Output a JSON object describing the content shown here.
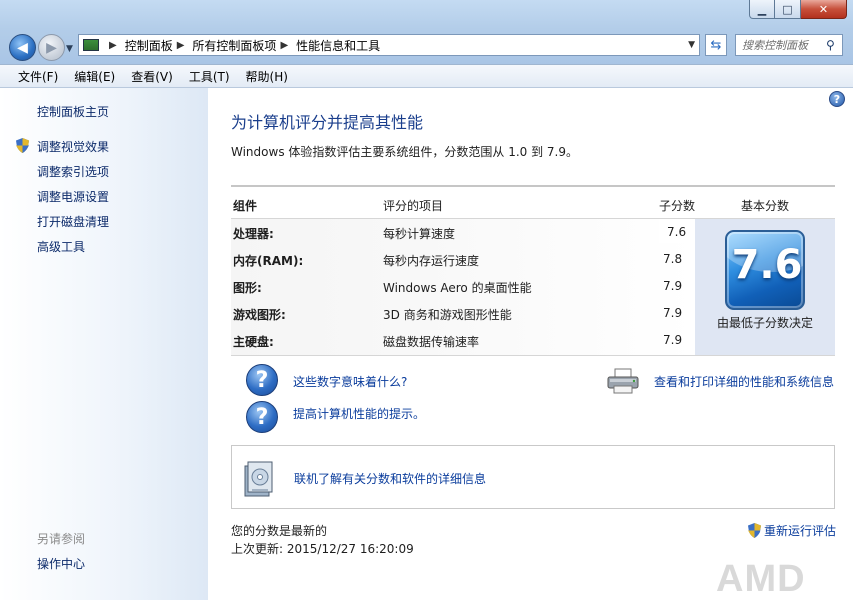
{
  "window": {
    "minimize": "▁",
    "maximize": "□",
    "close": "✕"
  },
  "nav": {
    "back_icon": "back-arrow-icon",
    "forward_icon": "forward-arrow-icon"
  },
  "address": {
    "crumbs": [
      "控制面板",
      "所有控制面板项",
      "性能信息和工具"
    ],
    "separator": "▶"
  },
  "search": {
    "placeholder": "搜索控制面板"
  },
  "menu": [
    "文件(F)",
    "编辑(E)",
    "查看(V)",
    "工具(T)",
    "帮助(H)"
  ],
  "sidebar": {
    "home": "控制面板主页",
    "links": [
      "调整视觉效果",
      "调整索引选项",
      "调整电源设置",
      "打开磁盘清理",
      "高级工具"
    ],
    "see_also": "另请参阅",
    "action_center": "操作中心"
  },
  "main": {
    "title": "为计算机评分并提高其性能",
    "subtitle": "Windows 体验指数评估主要系统组件，分数范围从 1.0 到 7.9。",
    "table": {
      "headers": {
        "component": "组件",
        "rated": "评分的项目",
        "subscore": "子分数",
        "basescore": "基本分数"
      },
      "rows": [
        {
          "component": "处理器:",
          "item": "每秒计算速度",
          "score": "7.6"
        },
        {
          "component": "内存(RAM):",
          "item": "每秒内存运行速度",
          "score": "7.8"
        },
        {
          "component": "图形:",
          "item": "Windows Aero 的桌面性能",
          "score": "7.9"
        },
        {
          "component": "游戏图形:",
          "item": "3D 商务和游戏图形性能",
          "score": "7.9"
        },
        {
          "component": "主硬盘:",
          "item": "磁盘数据传输速率",
          "score": "7.9"
        }
      ],
      "base_score": "7.6",
      "base_note": "由最低子分数决定"
    },
    "links": {
      "what_mean": "这些数字意味着什么?",
      "tips": "提高计算机性能的提示。",
      "print": "查看和打印详细的性能和系统信息",
      "online": "联机了解有关分数和软件的详细信息"
    },
    "status": {
      "current": "您的分数是最新的",
      "last_update": "上次更新: 2015/12/27 16:20:09",
      "rerun": "重新运行评估"
    },
    "watermark": "AMD"
  }
}
